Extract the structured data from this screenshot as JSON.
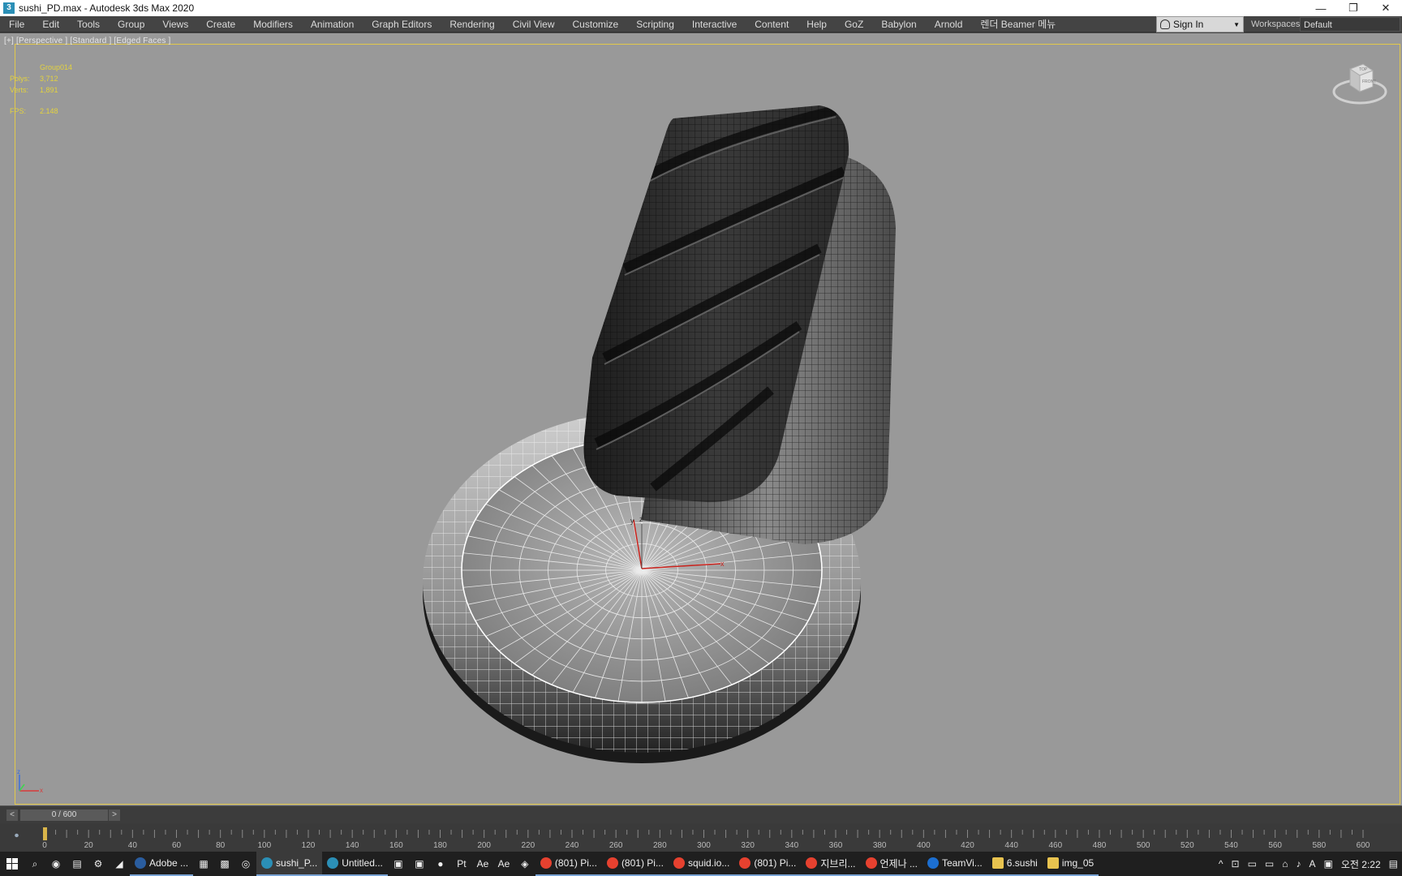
{
  "titlebar": {
    "icon": "3",
    "title": "sushi_PD.max - Autodesk 3ds Max 2020",
    "minimize": "—",
    "restore": "❐",
    "close": "✕"
  },
  "menu": [
    "File",
    "Edit",
    "Tools",
    "Group",
    "Views",
    "Create",
    "Modifiers",
    "Animation",
    "Graph Editors",
    "Rendering",
    "Civil View",
    "Customize",
    "Scripting",
    "Interactive",
    "Content",
    "Help",
    "GoZ",
    "Babylon",
    "Arnold",
    "렌더 Beamer 메뉴"
  ],
  "signin": {
    "label": "Sign In",
    "caret": "▼"
  },
  "workspaces": {
    "label": "Workspaces:",
    "value": "Default"
  },
  "viewport": {
    "label": "[+] [Perspective ] [Standard ] [Edged Faces ]",
    "object_name": "Group014",
    "stats": [
      {
        "key": "Polys:",
        "value": "3,712"
      },
      {
        "key": "Verts:",
        "value": "1,891"
      },
      {
        "key": "FPS:",
        "value": "2.148"
      }
    ],
    "viewcube": {
      "top": "TOP",
      "front": "FRONT"
    },
    "tripod": {
      "z": "z",
      "x": "x"
    },
    "gizmo": {
      "y": "y",
      "z": "z",
      "x": "x"
    }
  },
  "timeslider": {
    "prev": "<",
    "next": ">",
    "frame": "0 / 600"
  },
  "trackbar": {
    "icon": "⏺",
    "ticks": [
      "0",
      "20",
      "40",
      "60",
      "80",
      "100",
      "120",
      "140",
      "160",
      "180",
      "200",
      "220",
      "240",
      "260",
      "280",
      "300",
      "320",
      "340",
      "360",
      "380",
      "400",
      "420",
      "440",
      "460",
      "480",
      "500",
      "520",
      "540",
      "560",
      "580",
      "600"
    ]
  },
  "taskbar": {
    "apps": [
      {
        "label": "Adobe ...",
        "color": "#2a5d9f"
      },
      {
        "label": "sushi_P...",
        "color": "#2b8fb6",
        "active": true
      },
      {
        "label": "Untitled...",
        "color": "#2b8fb6"
      },
      {
        "label": "(801) Pi...",
        "color": "#e6412f"
      },
      {
        "label": "(801) Pi...",
        "color": "#e6412f"
      },
      {
        "label": "squid.io...",
        "color": "#e6412f"
      },
      {
        "label": "(801) Pi...",
        "color": "#e6412f"
      },
      {
        "label": "지브리...",
        "color": "#e6412f"
      },
      {
        "label": "언제나 ...",
        "color": "#e6412f"
      },
      {
        "label": "TeamVi...",
        "color": "#1c6fd1"
      },
      {
        "label": "6.sushi",
        "color": "#e8c34f"
      },
      {
        "label": "img_05",
        "color": "#e8c34f"
      }
    ],
    "tray_time": "오전 2:22",
    "tray_lang": "A"
  }
}
